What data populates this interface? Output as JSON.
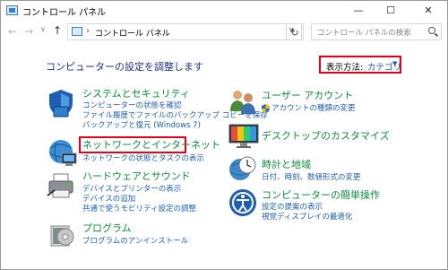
{
  "window": {
    "title": "コントロール パネル",
    "minimize": "—",
    "maximize": "☐",
    "close": "✕"
  },
  "nav": {
    "back": "←",
    "forward": "→",
    "recent": "∨",
    "up": "↑",
    "address_separator": "›",
    "address": "コントロール パネル",
    "address_dropdown": "∨",
    "refresh": "↻",
    "search_placeholder": "コントロール パネルの検索"
  },
  "heading": "コンピューターの設定を調整します",
  "view_by": {
    "label": "表示方法:",
    "value": "カテゴリ",
    "caret": "▼"
  },
  "categories_left": [
    {
      "title": "システムとセキュリティ",
      "links": [
        "コンピューターの状態を確認",
        "ファイル履歴でファイルのバックアップ コピーを保存",
        "バックアップと復元 (Windows 7)"
      ],
      "icon": "security-shield-icon"
    },
    {
      "title": "ネットワークとインターネット",
      "links": [
        "ネットワークの状態とタスクの表示"
      ],
      "icon": "network-globe-icon",
      "highlighted": true
    },
    {
      "title": "ハードウェアとサウンド",
      "links": [
        "デバイスとプリンターの表示",
        "デバイスの追加",
        "共通で使うモビリティ設定の調整"
      ],
      "icon": "printer-icon"
    },
    {
      "title": "プログラム",
      "links": [
        "プログラムのアンインストール"
      ],
      "icon": "programs-disc-icon"
    }
  ],
  "categories_right": [
    {
      "title": "ユーザー アカウント",
      "links": [
        "アカウントの種類の変更"
      ],
      "icon": "users-icon"
    },
    {
      "title": "デスクトップのカスタマイズ",
      "links": [],
      "icon": "monitor-icon"
    },
    {
      "title": "時計と地域",
      "links": [
        "日付、時刻、数値形式の変更"
      ],
      "icon": "clock-globe-icon"
    },
    {
      "title": "コンピューターの簡単操作",
      "links": [
        "設定の提案の表示",
        "視覚ディスプレイの最適化"
      ],
      "icon": "ease-of-access-icon"
    }
  ],
  "colors": {
    "category_title": "#0a8f3c",
    "link": "#1e5fb4",
    "heading": "#1e3287",
    "highlight_border": "#e5001a"
  }
}
